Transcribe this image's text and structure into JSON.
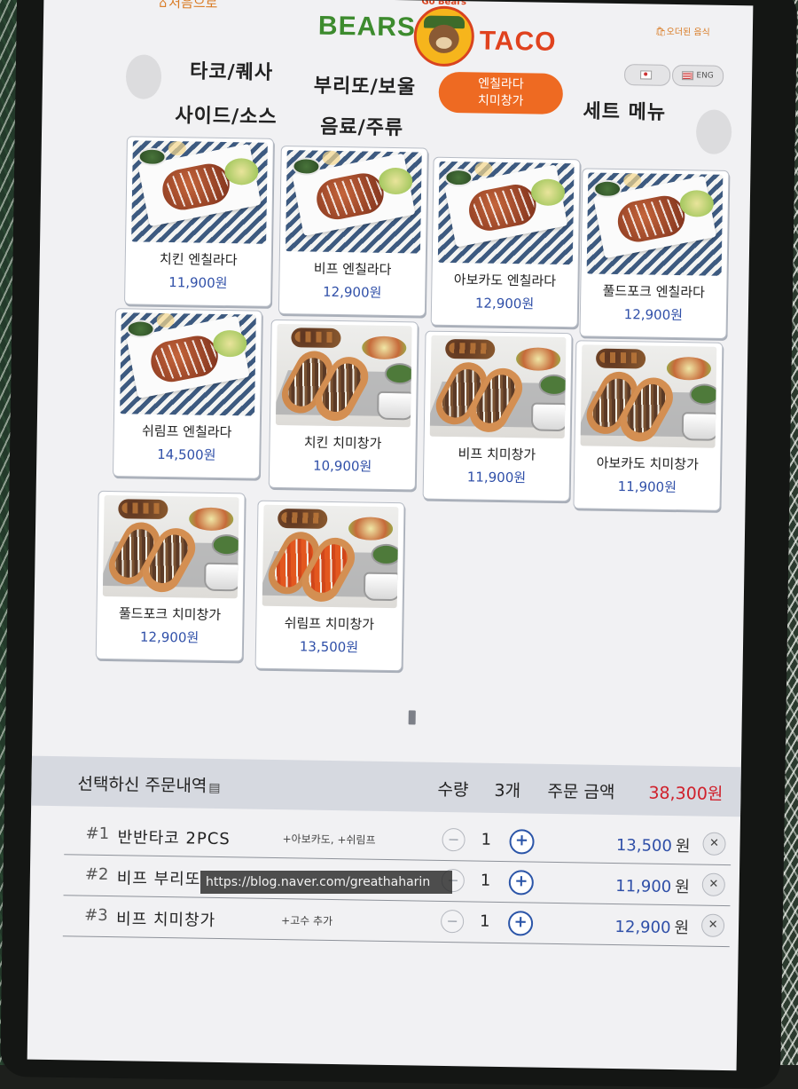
{
  "header": {
    "home_label": "처음으로",
    "logo_bears": "BEARS",
    "logo_taco": "TACO",
    "logo_tagline": "Go Bears",
    "cart_link": "오더된 음식",
    "lang_kr": "",
    "lang_en": "ENG"
  },
  "categories": {
    "taco": "타코/퀘사",
    "burrito": "부리또/보울",
    "active_line1": "엔칠라다",
    "active_line2": "치미창가",
    "set_menu": "세트 메뉴",
    "side": "사이드/소스",
    "drinks": "음료/주류"
  },
  "menu": [
    {
      "name": "치킨 엔칠라다",
      "price": "11,900원",
      "photo": "enchilada"
    },
    {
      "name": "비프 엔칠라다",
      "price": "12,900원",
      "photo": "enchilada"
    },
    {
      "name": "아보카도 엔칠라다",
      "price": "12,900원",
      "photo": "enchilada"
    },
    {
      "name": "풀드포크 엔칠라다",
      "price": "12,900원",
      "photo": "enchilada"
    },
    {
      "name": "쉬림프 엔칠라다",
      "price": "14,500원",
      "photo": "enchilada"
    },
    {
      "name": "치킨 치미창가",
      "price": "10,900원",
      "photo": "chimichanga"
    },
    {
      "name": "비프 치미창가",
      "price": "11,900원",
      "photo": "chimichanga"
    },
    {
      "name": "아보카도 치미창가",
      "price": "11,900원",
      "photo": "chimichanga"
    },
    {
      "name": "풀드포크 치미창가",
      "price": "12,900원",
      "photo": "chimichanga"
    },
    {
      "name": "쉬림프 치미창가",
      "price": "13,500원",
      "photo": "chimichanga-shrimp"
    }
  ],
  "order": {
    "title": "선택하신 주문내역",
    "qty_label": "수량",
    "qty_total": "3개",
    "total_label": "주문 금액",
    "total_value": "38,300원",
    "unit": "원",
    "items": [
      {
        "num": "#1",
        "name": "반반타코 2PCS",
        "options": "+아보카도, +쉬림프",
        "qty": "1",
        "price": "13,500"
      },
      {
        "num": "#2",
        "name": "비프 부리또",
        "options": "",
        "qty": "1",
        "price": "11,900"
      },
      {
        "num": "#3",
        "name": "비프 치미창가",
        "options": "+고수 추가",
        "qty": "1",
        "price": "12,900"
      }
    ]
  },
  "watermark": "https://blog.naver.com/greathaharin",
  "colors": {
    "accent_orange": "#ee6a22",
    "price_blue": "#2f4fa8",
    "total_red": "#d0202b",
    "logo_green": "#3d8b2e",
    "logo_red": "#e0421e"
  }
}
